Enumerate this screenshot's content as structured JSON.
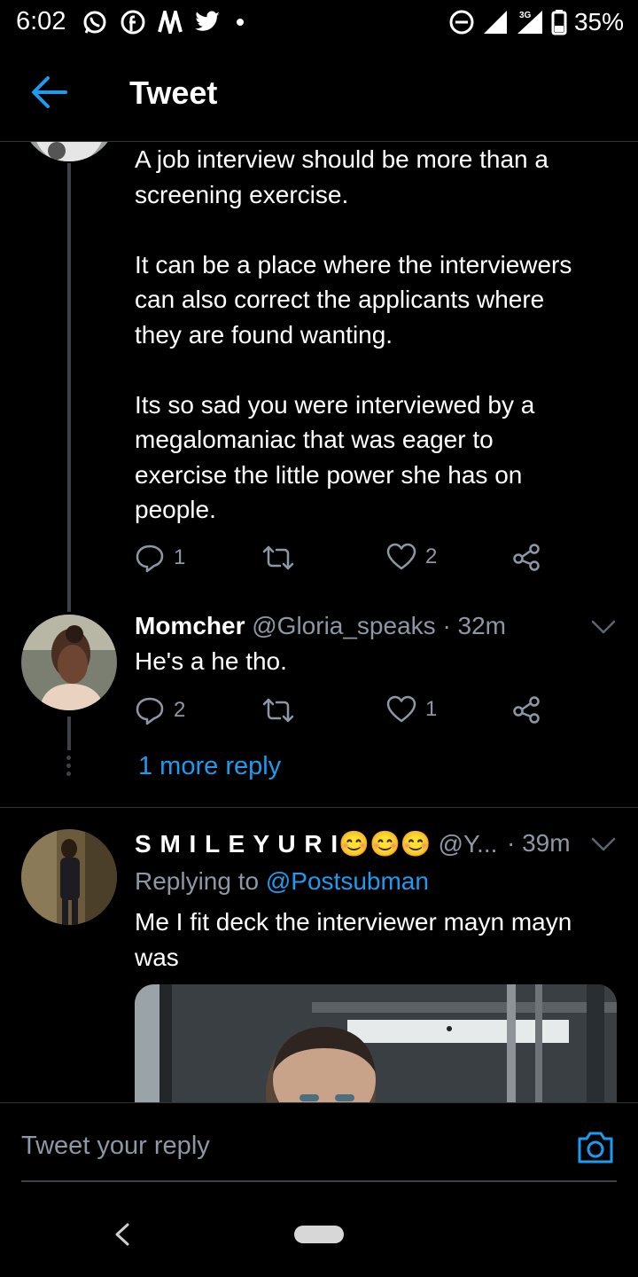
{
  "status_bar": {
    "time": "6:02",
    "left_icons": [
      "whatsapp-icon",
      "facebook-icon",
      "news-icon",
      "twitter-icon",
      "dot-icon"
    ],
    "network": "3G",
    "battery": "35%"
  },
  "header": {
    "title": "Tweet"
  },
  "tweets": [
    {
      "text": "A job interview should be more than a\nscreening exercise.\n\nIt can be a place where the interviewers\ncan also correct the applicants where\nthey are found wanting.\n\nIts so sad you were interviewed by a\nmegalomaniac that was eager to\nexercise the little power she has on\npeople.",
      "replies": "1",
      "likes": "2"
    },
    {
      "name": "Momcher",
      "handle": "@Gloria_speaks",
      "time": "· 32m",
      "text": "He's a he tho.",
      "replies": "2",
      "likes": "1"
    },
    {
      "name": "S M I L E Y U R I",
      "name_emoji": "😊😊😊",
      "handle": "@Y...",
      "time": "· 39m",
      "replying_prefix": "Replying to ",
      "replying_to": "@Postsubman",
      "text": "Me I fit deck the interviewer mayn mayn\nwas"
    }
  ],
  "more_replies": "1 more reply",
  "reply_box": {
    "placeholder": "Tweet your reply"
  },
  "colors": {
    "accent": "#1d9bf0",
    "muted": "#8b98a5",
    "divider": "#2f3336",
    "background": "#000000"
  }
}
